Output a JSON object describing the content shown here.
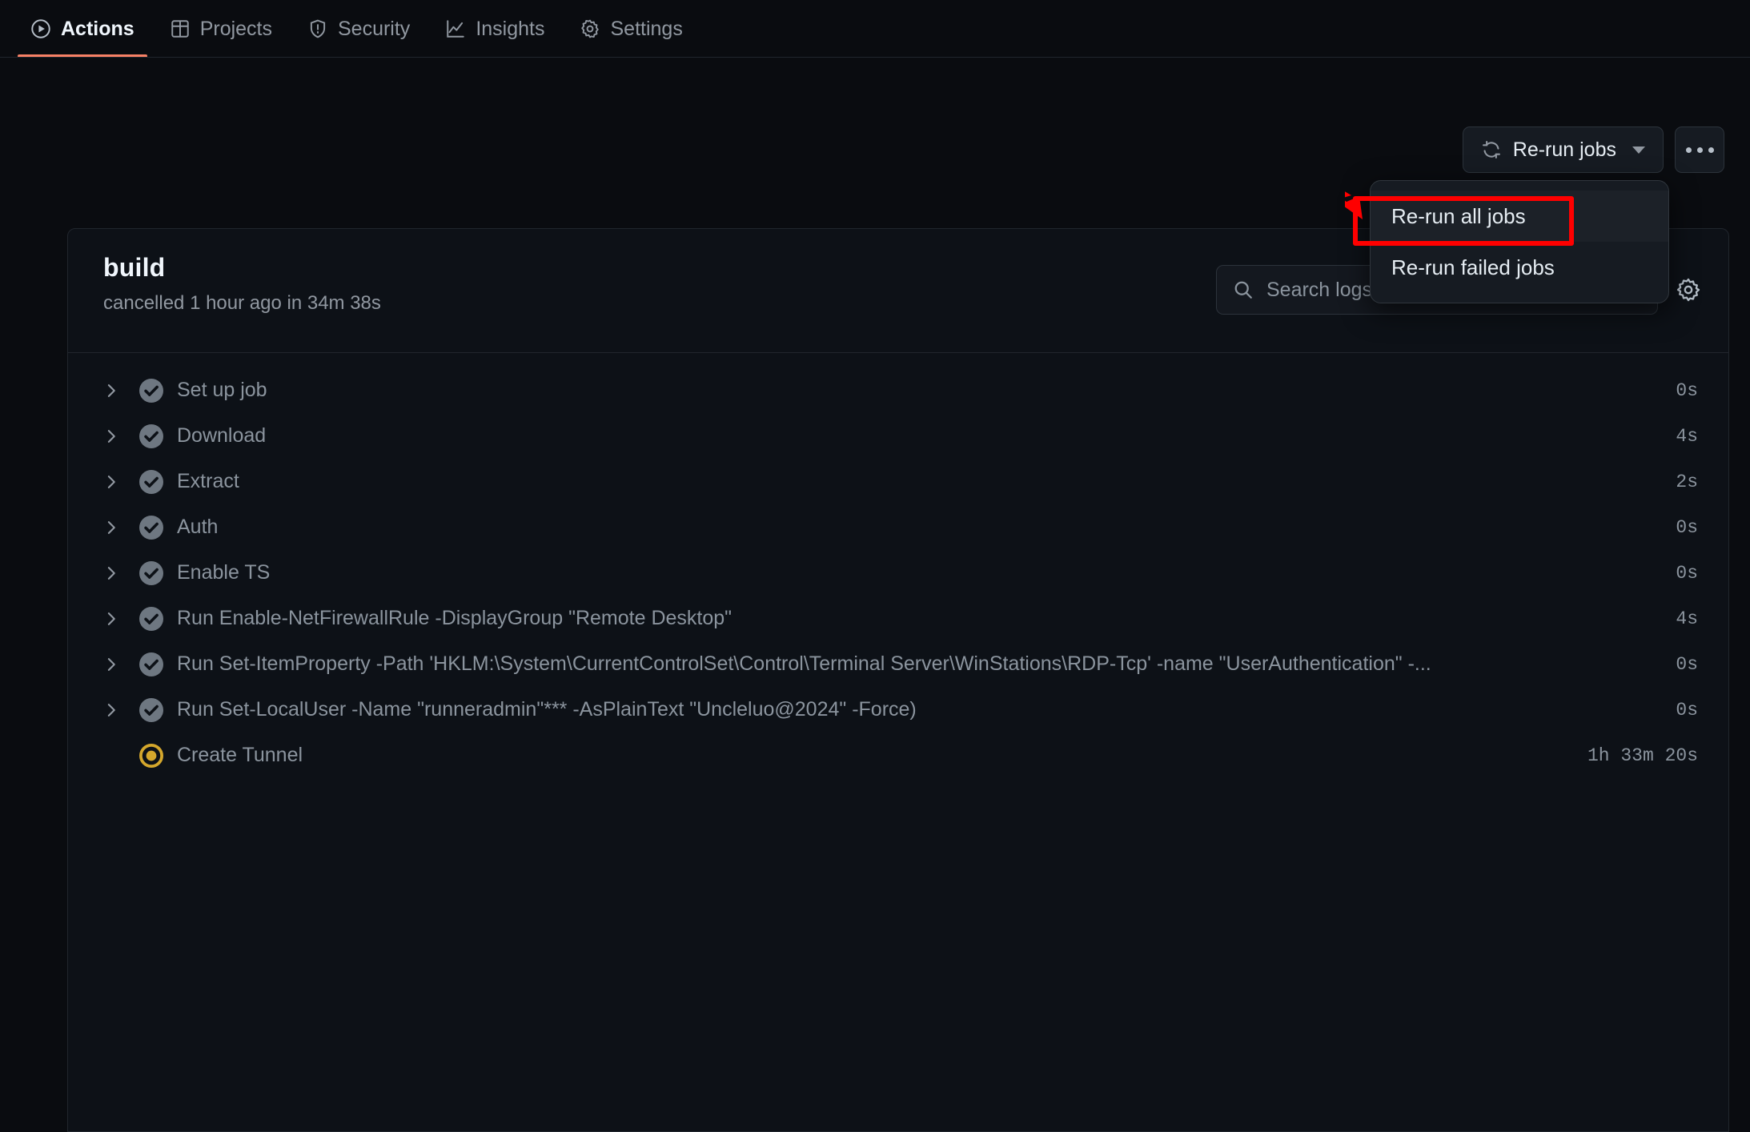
{
  "nav": {
    "items": [
      {
        "label": "Actions",
        "icon": "play-circle-icon",
        "active": true
      },
      {
        "label": "Projects",
        "icon": "table-icon",
        "active": false
      },
      {
        "label": "Security",
        "icon": "shield-alert-icon",
        "active": false
      },
      {
        "label": "Insights",
        "icon": "graph-icon",
        "active": false
      },
      {
        "label": "Settings",
        "icon": "gear-icon",
        "active": false
      }
    ]
  },
  "toolbar": {
    "rerun_label": "Re-run jobs",
    "rerun_icon": "refresh-icon",
    "caret_icon": "chevron-down-icon",
    "kebab_icon": "kebab-horizontal-icon"
  },
  "dropdown": {
    "items": [
      {
        "label": "Re-run all jobs",
        "highlighted": true
      },
      {
        "label": "Re-run failed jobs",
        "highlighted": false
      }
    ]
  },
  "annotation": {
    "color": "#ff0000",
    "arrow": "red-arrow-pointing-to-re-run-all-jobs",
    "box": "red-highlight-box"
  },
  "job": {
    "title": "build",
    "status_text": "cancelled 1 hour ago in 34m 38s"
  },
  "search": {
    "placeholder": "Search logs",
    "value": "",
    "icon": "search-icon"
  },
  "settings_icon": "gear-icon",
  "steps": [
    {
      "label": "Set up job",
      "duration": "0s",
      "status": "success",
      "expandable": true
    },
    {
      "label": "Download",
      "duration": "4s",
      "status": "success",
      "expandable": true
    },
    {
      "label": "Extract",
      "duration": "2s",
      "status": "success",
      "expandable": true
    },
    {
      "label": "Auth",
      "duration": "0s",
      "status": "success",
      "expandable": true
    },
    {
      "label": "Enable TS",
      "duration": "0s",
      "status": "success",
      "expandable": true
    },
    {
      "label": "Run Enable-NetFirewallRule -DisplayGroup \"Remote Desktop\"",
      "duration": "4s",
      "status": "success",
      "expandable": true
    },
    {
      "label": "Run Set-ItemProperty -Path 'HKLM:\\System\\CurrentControlSet\\Control\\Terminal Server\\WinStations\\RDP-Tcp' -name \"UserAuthentication\" -...",
      "duration": "0s",
      "status": "success",
      "expandable": true
    },
    {
      "label": "Run Set-LocalUser -Name \"runneradmin\"*** -AsPlainText \"Uncleluo@2024\" -Force)",
      "duration": "0s",
      "status": "success",
      "expandable": true
    },
    {
      "label": "Create Tunnel",
      "duration": "1h 33m 20s",
      "status": "cancelled",
      "expandable": false
    }
  ],
  "colors": {
    "accent": "#f78166",
    "page_bg": "#0a0c10",
    "panel_bg": "#0d1117",
    "success_icon": "#6e7781",
    "cancelled_icon": "#d4a72c",
    "annotation_red": "#ff0000"
  }
}
